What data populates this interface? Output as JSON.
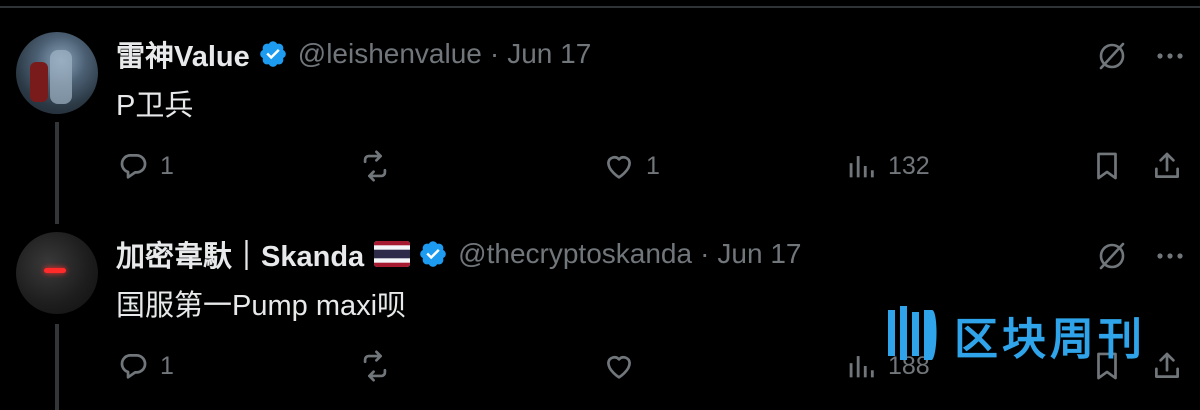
{
  "tweets": [
    {
      "display_name": "雷神Value",
      "handle": "@leishenvalue",
      "separator": "·",
      "date": "Jun 17",
      "text": "P卫兵",
      "reply_count": "1",
      "retweet_count": "",
      "like_count": "1",
      "view_count": "132"
    },
    {
      "display_name": "加密韋馱｜Skanda",
      "handle": "@thecryptoskanda",
      "separator": "·",
      "date": "Jun 17",
      "text": "国服第一Pump maxi呗",
      "reply_count": "1",
      "retweet_count": "",
      "like_count": "",
      "view_count": "188"
    }
  ],
  "watermark": {
    "text": "区块周刊"
  },
  "colors": {
    "background": "#000000",
    "text_primary": "#e7e9ea",
    "text_secondary": "#71767b",
    "verified_blue": "#1d9bf0",
    "watermark_blue": "#2fa4ea"
  }
}
